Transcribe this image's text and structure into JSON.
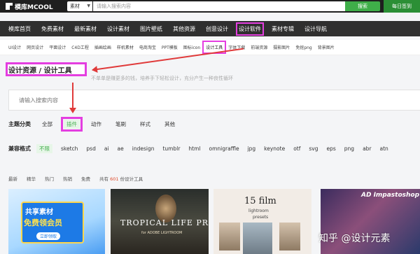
{
  "topbar": {
    "logo": "模库MCOOL",
    "category_select": "素材",
    "search_placeholder": "请输入搜索内容",
    "search_button": "搜索",
    "checkin": "每日签到"
  },
  "mainnav": [
    "模库首页",
    "免费素材",
    "最新素材",
    "设计素材",
    "图片壁纸",
    "其他资源",
    "创意设计",
    "设计软件",
    "素材专辑",
    "设计导航"
  ],
  "subnav": [
    "UI设计",
    "网页设计",
    "平面设计",
    "C4D工程",
    "插画绘画",
    "样机素材",
    "电商淘宝",
    "PPT模板",
    "图标icon",
    "设计工具",
    "字体下载",
    "前端资源",
    "摄影图片",
    "免抠png",
    "背景图片"
  ],
  "page": {
    "title": "设计资源 / 设计工具",
    "subtitle": "不单单是赚更多的钱，培养手下轻松设计，充分产生一种良性循环",
    "search_placeholder": "请输入搜索内容"
  },
  "filters": {
    "topic_label": "主题分类",
    "topic_options": [
      "全部",
      "插件",
      "动作",
      "笔刷",
      "样式",
      "其他"
    ],
    "format_label": "兼容格式",
    "format_options": [
      "不限",
      "sketch",
      "psd",
      "ai",
      "ae",
      "indesign",
      "tumblr",
      "html",
      "omnigraffle",
      "jpg",
      "keynote",
      "otf",
      "svg",
      "eps",
      "png",
      "abr",
      "atn"
    ]
  },
  "sort": {
    "options": [
      "最新",
      "精华",
      "热门",
      "热销",
      "免费"
    ],
    "count_prefix": "共有",
    "count": "601",
    "count_suffix": "份设计工具"
  },
  "cards": {
    "card1_line1": "共享素材",
    "card1_line2": "免费领会员",
    "card1_btn": "立即领取",
    "card2_title": "TROPICAL LIFE PRESETS",
    "card2_sub": "for ADOBE LIGHTROOM",
    "card3_title": "15 film",
    "card3_sub1": "lightroom",
    "card3_sub2": "presets",
    "card4_title": "AD Impastoshop"
  },
  "watermark": "知乎 @设计元素",
  "colors": {
    "accent_green": "#3fae49",
    "highlight_magenta": "#e43ee0",
    "arrow_red": "#e03a3a"
  }
}
